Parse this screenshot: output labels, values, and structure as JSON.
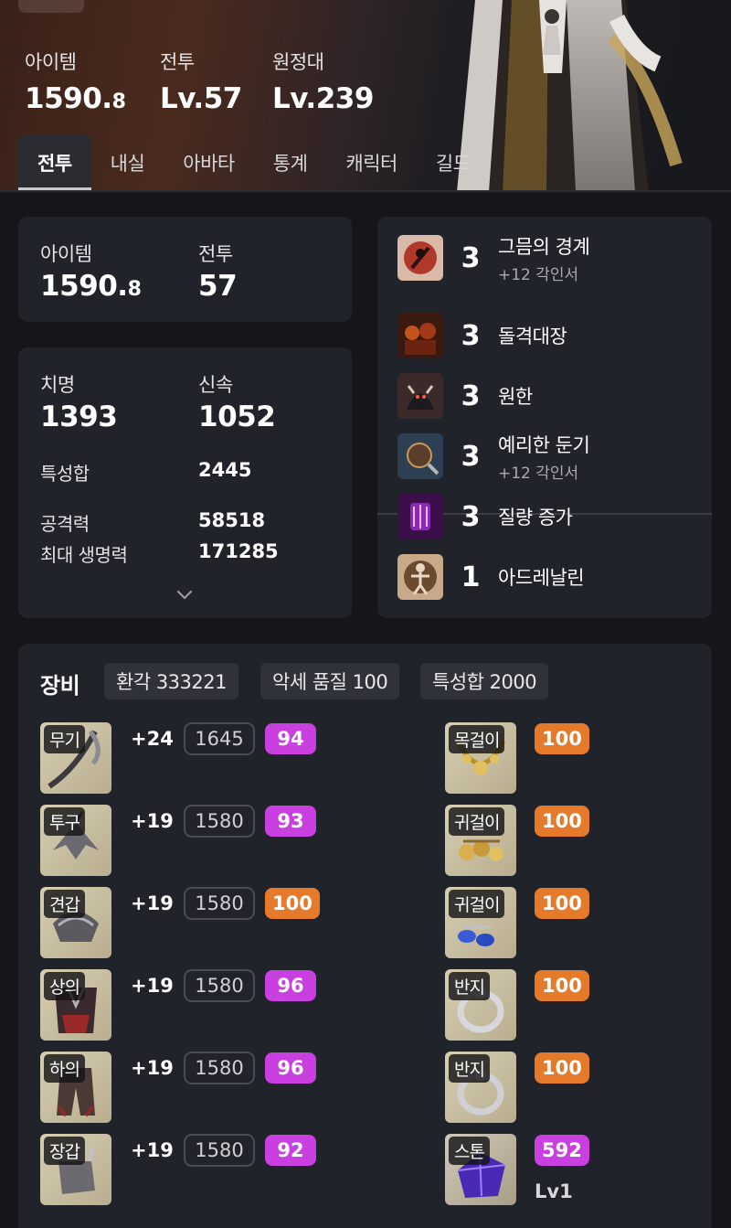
{
  "header": {
    "stats": [
      {
        "label": "아이템",
        "value": "1590.",
        "decimal": "8"
      },
      {
        "label": "전투",
        "value": "Lv.57",
        "decimal": ""
      },
      {
        "label": "원정대",
        "value": "Lv.239",
        "decimal": ""
      }
    ],
    "tabs": [
      "전투",
      "내실",
      "아바타",
      "통계",
      "캐릭터",
      "길드"
    ],
    "active_tab": "전투"
  },
  "item_card": {
    "item_label": "아이템",
    "item_value": "1590.",
    "item_decimal": "8",
    "combat_label": "전투",
    "combat_value": "57"
  },
  "stats_card": {
    "crit_label": "치명",
    "crit_value": "1393",
    "swift_label": "신속",
    "swift_value": "1052",
    "total_label": "특성합",
    "total_value": "2445",
    "atk_label": "공격력",
    "atk_value": "58518",
    "hp_label": "최대 생명력",
    "hp_value": "171285"
  },
  "engravings": [
    {
      "level": "3",
      "name": "그믐의 경계",
      "sub": "+12 각인서",
      "icon": "grudge-moon-icon",
      "color": "#b0392c"
    },
    {
      "level": "3",
      "name": "돌격대장",
      "sub": "",
      "icon": "raid-captain-icon",
      "color": "#8a2a18"
    },
    {
      "level": "3",
      "name": "원한",
      "sub": "",
      "icon": "grudge-icon",
      "color": "#5a2c2a"
    },
    {
      "level": "3",
      "name": "예리한 둔기",
      "sub": "+12 각인서",
      "icon": "keen-blunt-icon",
      "color": "#2d3f52"
    },
    {
      "level": "3",
      "name": "질량 증가",
      "sub": "",
      "icon": "mass-increase-icon",
      "color": "#8b2ab5"
    },
    {
      "level": "1",
      "name": "아드레날린",
      "sub": "",
      "icon": "adrenaline-icon",
      "color": "#6b4a2e"
    }
  ],
  "equipment": {
    "title": "장비",
    "chips": [
      "환각 333221",
      "악세 품질 100",
      "특성합 2000"
    ],
    "gear": [
      {
        "slot": "무기",
        "enhance": "+24",
        "ilvl": "1645",
        "quality": "94",
        "qcolor": "purple"
      },
      {
        "slot": "투구",
        "enhance": "+19",
        "ilvl": "1580",
        "quality": "93",
        "qcolor": "purple"
      },
      {
        "slot": "견갑",
        "enhance": "+19",
        "ilvl": "1580",
        "quality": "100",
        "qcolor": "orange"
      },
      {
        "slot": "상의",
        "enhance": "+19",
        "ilvl": "1580",
        "quality": "96",
        "qcolor": "purple"
      },
      {
        "slot": "하의",
        "enhance": "+19",
        "ilvl": "1580",
        "quality": "96",
        "qcolor": "purple"
      },
      {
        "slot": "장갑",
        "enhance": "+19",
        "ilvl": "1580",
        "quality": "92",
        "qcolor": "purple"
      }
    ],
    "accessories": [
      {
        "slot": "목걸이",
        "quality": "100",
        "qcolor": "orange"
      },
      {
        "slot": "귀걸이",
        "quality": "100",
        "qcolor": "orange"
      },
      {
        "slot": "귀걸이",
        "quality": "100",
        "qcolor": "orange"
      },
      {
        "slot": "반지",
        "quality": "100",
        "qcolor": "orange"
      },
      {
        "slot": "반지",
        "quality": "100",
        "qcolor": "orange"
      },
      {
        "slot": "스톤",
        "quality": "592",
        "qcolor": "purple",
        "level": "Lv1"
      }
    ]
  },
  "icons": {
    "expand": "chevron-down-icon"
  }
}
